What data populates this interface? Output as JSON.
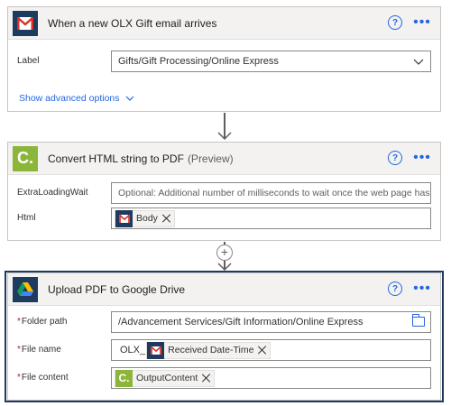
{
  "trigger": {
    "title": "When a new OLX Gift email arrives",
    "label_field_label": "Label",
    "label_field_value": "Gifts/Gift Processing/Online Express",
    "advanced_link": "Show advanced options",
    "icon": "gmail-icon"
  },
  "convert": {
    "title": "Convert HTML string to PDF",
    "title_suffix": "(Preview)",
    "icon_letter": "C.",
    "extra_label": "ExtraLoadingWait",
    "extra_placeholder": "Optional: Additional number of milliseconds to wait once the web page has fini",
    "html_label": "Html",
    "html_token": "Body"
  },
  "upload": {
    "title": "Upload PDF to Google Drive",
    "icon": "google-drive-icon",
    "required_marker": "*",
    "folder_label": "Folder path",
    "folder_value": "/Advancement Services/Gift Information/Online Express",
    "filename_label": "File name",
    "filename_prefix": "OLX_",
    "filename_token": "Received Date-Time",
    "filecontent_label": "File content",
    "filecontent_token": "OutputContent"
  },
  "common": {
    "help_glyph": "?",
    "more_glyph": "•••",
    "plus_glyph": "+"
  },
  "colors": {
    "accent": "#2266e3",
    "gmail_red": "#d93025",
    "convert_green": "#8bb63a",
    "card_header_bg": "#f3f2f1",
    "selected_border": "#1f3a5f"
  }
}
